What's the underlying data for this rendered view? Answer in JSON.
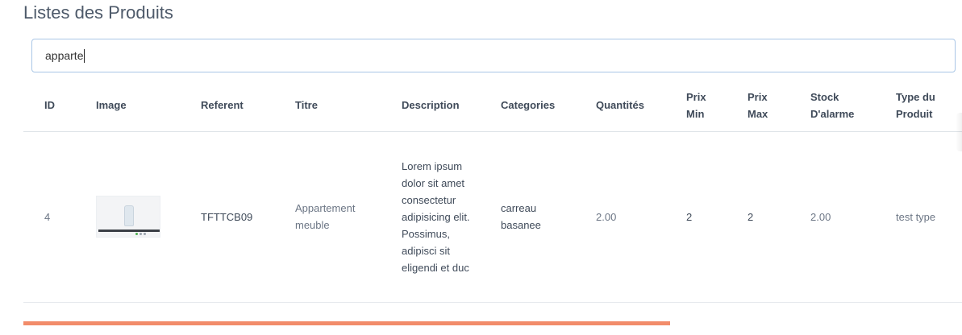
{
  "page": {
    "title": "Listes des Produits"
  },
  "search": {
    "value": "apparte"
  },
  "table": {
    "headers": {
      "id": "ID",
      "image": "Image",
      "referent": "Referent",
      "titre": "Titre",
      "description": "Description",
      "categories": "Categories",
      "quantites": "Quantités",
      "prix_min": "Prix Min",
      "prix_max": "Prix Max",
      "stock_alarme": "Stock D'alarme",
      "type_produit": "Type du Produit"
    },
    "rows": [
      {
        "id": "4",
        "image_icon": "product-thumbnail-image",
        "referent": "TFTTCB09",
        "titre": "Appartement meuble",
        "description": "Lorem ipsum dolor sit amet consectetur adipisicing elit. Possimus, adipisci sit eligendi et duc",
        "categories": "carreau basanee",
        "quantites": "2.00",
        "prix_min": "2",
        "prix_max": "2",
        "stock_alarme": "2.00",
        "type_produit": "test type"
      }
    ]
  },
  "progress": {
    "color": "#f28c6a"
  },
  "colors": {
    "text_dark": "#3f4a59",
    "text_muted": "#6c7685",
    "input_border": "#a9c6e6"
  }
}
